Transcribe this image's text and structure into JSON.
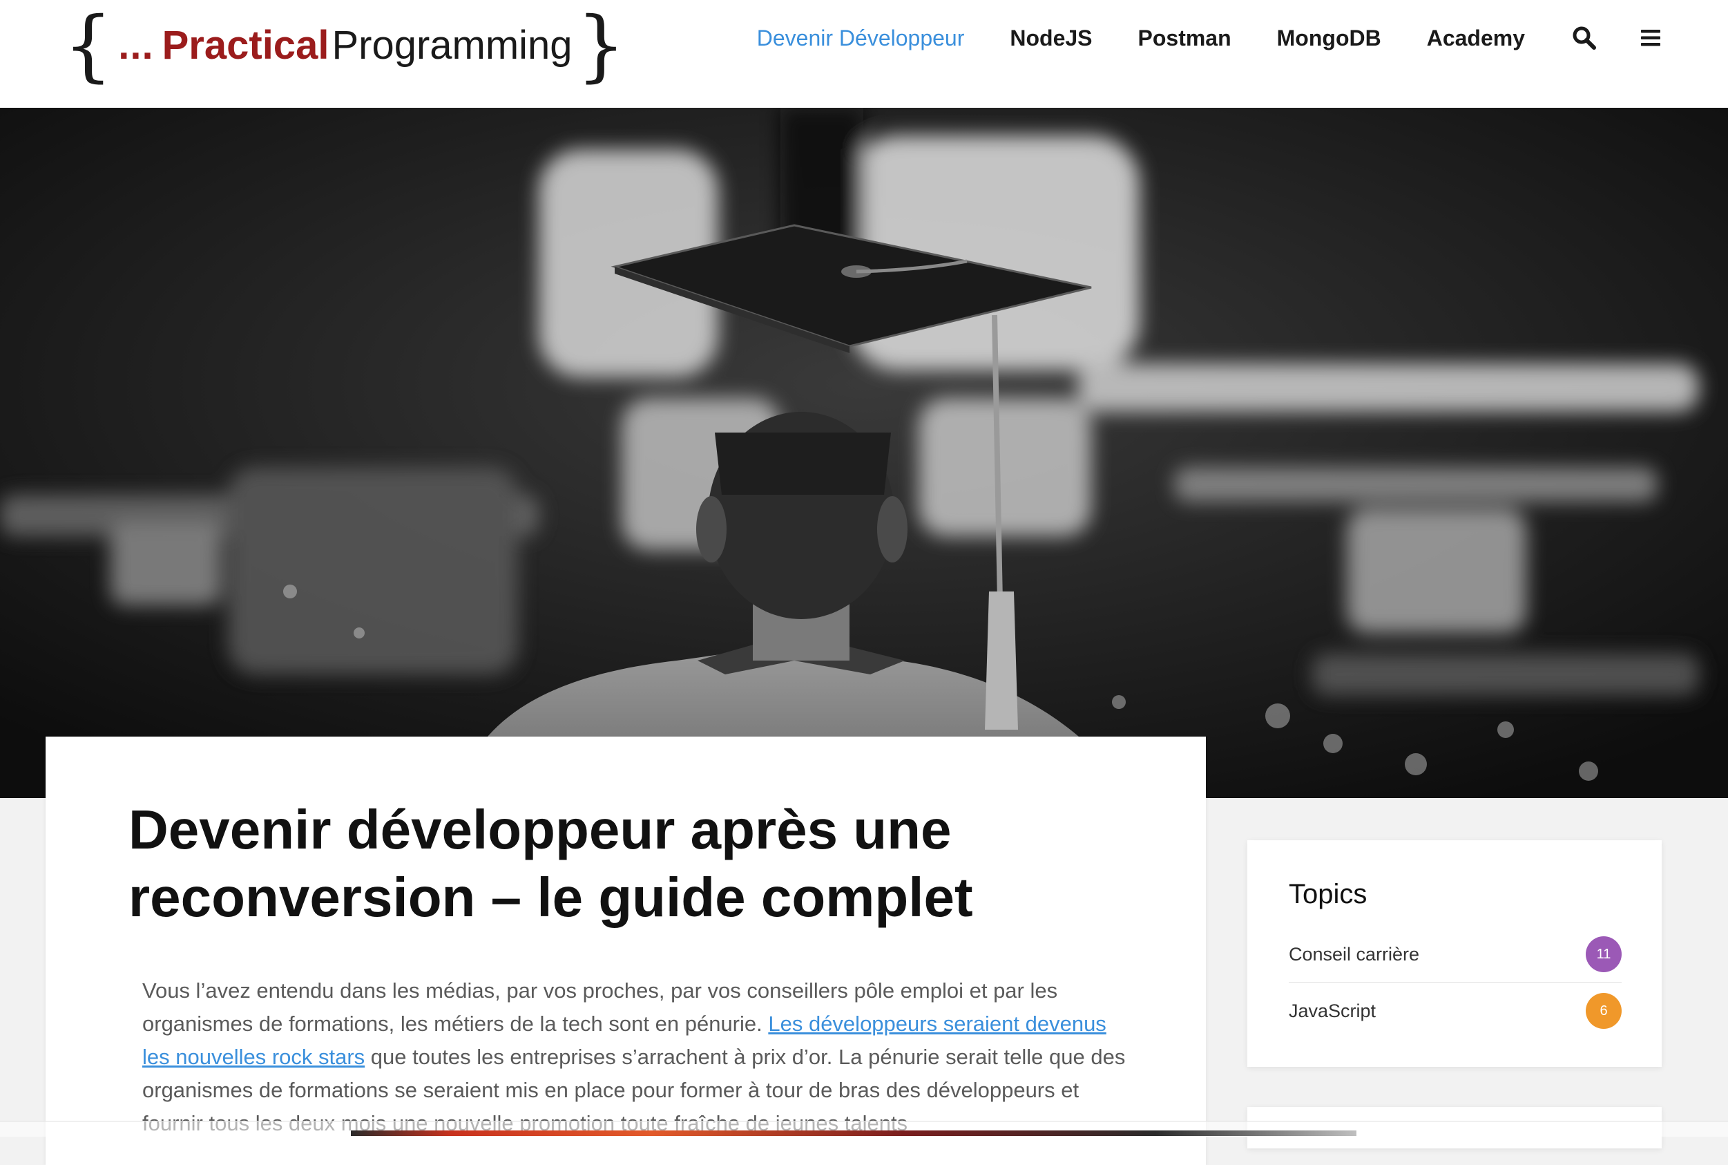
{
  "site": {
    "logo": {
      "brace_open": "{",
      "ellipsis": "...",
      "word1": "Practical",
      "word2": "Programming",
      "brace_close": "}"
    },
    "nav": {
      "items": [
        {
          "label": "Devenir Développeur",
          "active": true
        },
        {
          "label": "NodeJS",
          "active": false
        },
        {
          "label": "Postman",
          "active": false
        },
        {
          "label": "MongoDB",
          "active": false
        },
        {
          "label": "Academy",
          "active": false
        }
      ],
      "search_icon": "search-icon",
      "menu_icon": "hamburger-menu-icon"
    }
  },
  "hero": {
    "image": "graduate-in-cap-black-and-white-photo"
  },
  "article": {
    "title": "Devenir développeur après une reconversion – le guide complet",
    "body_before_link": "Vous l’avez entendu dans les médias, par vos proches, par vos conseillers pôle emploi et par les organismes de formations, les métiers de la tech sont en pénurie. ",
    "body_link": "Les développeurs seraient devenus les nouvelles rock stars",
    "body_after_link": " que toutes les entreprises s’arrachent à prix d’or. La pénurie serait telle que des organismes de formations se seraient mis en place pour former à tour de bras des développeurs et fournir tous les deux mois une nouvelle promotion toute fraîche de jeunes talents"
  },
  "sidebar": {
    "topics": {
      "title": "Topics",
      "items": [
        {
          "label": "Conseil carrière",
          "count": "11",
          "color": "#9b59b6"
        },
        {
          "label": "JavaScript",
          "count": "6",
          "color": "#f0982a"
        }
      ]
    }
  },
  "colors": {
    "accent": "#3a8fdc",
    "brand_red": "#9b1c1c"
  }
}
